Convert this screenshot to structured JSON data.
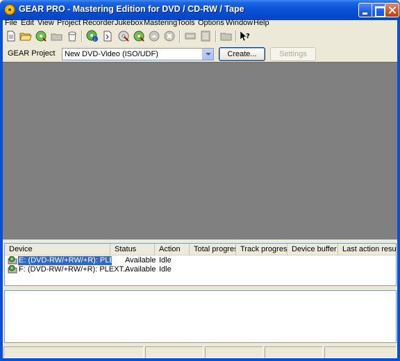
{
  "window": {
    "title": "GEAR PRO - Mastering Edition for DVD / CD-RW / Tape"
  },
  "menu": [
    "File",
    "Edit",
    "View",
    "Project",
    "Recorder",
    "Jukebox",
    "Mastering",
    "Tools",
    "Options",
    "Window",
    "Help"
  ],
  "toolbar": {
    "icons": [
      "new-project-icon",
      "open-project-icon",
      "add-to-project-icon",
      "open-folder-icon",
      "save-icon",
      "disc-info-icon",
      "import-session-icon",
      "erase-disc-icon",
      "copy-disc-icon",
      "eject-icon",
      "disc-disabled-icon",
      "device-log-icon",
      "properties-icon",
      "folder-icon",
      "help-pointer-icon"
    ]
  },
  "project": {
    "label": "GEAR Project",
    "type_value": "New DVD-Video (ISO/UDF)",
    "create_label": "Create...",
    "settings_label": "Settings"
  },
  "devices": {
    "columns": [
      "Device",
      "Status",
      "Action",
      "Total progress",
      "Track progress",
      "Device buffer",
      "Last action result"
    ],
    "rows": [
      {
        "device": "E: (DVD-RW/+RW/+R):  PLEX...",
        "status": "Available",
        "action": "Idle",
        "selected": true
      },
      {
        "device": "F: (DVD-RW/+RW/+R):  PLEXT...",
        "status": "Available",
        "action": "Idle",
        "selected": false
      }
    ]
  },
  "colors": {
    "titlebar": "#0a54d8",
    "workspace": "#808080",
    "selection": "#316ac5",
    "face": "#ece9d8"
  }
}
